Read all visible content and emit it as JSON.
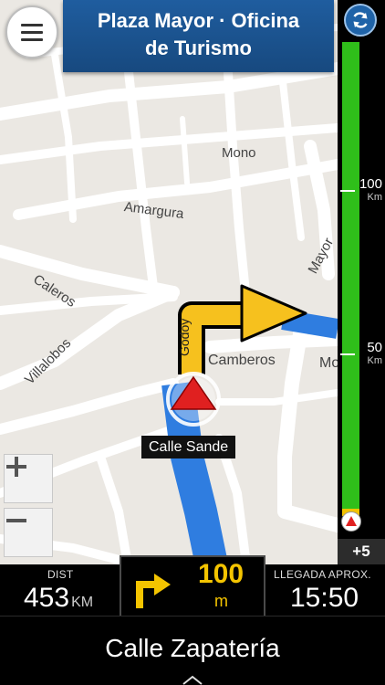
{
  "header": {
    "destination_line1": "Plaza Mayor · Oficina",
    "destination_line2": "de Turismo",
    "menu_icon": "hamburger-menu-icon",
    "refresh_icon": "refresh-icon"
  },
  "map": {
    "streets": {
      "mono": "Mono",
      "amargura": "Amargura",
      "caleros": "Caleros",
      "villalobos": "Villalobos",
      "godoy": "Godoy",
      "camberos": "Camberos",
      "mayor": "Mayor",
      "mo_partial": "Mo"
    },
    "current_street_callout": "Calle Sande",
    "zoom_in_label": "+",
    "zoom_out_label": "−",
    "colors": {
      "background": "#ebe8e3",
      "road": "#ffffff",
      "route": "#2f7de0",
      "maneuver_arrow": "#f6c11e",
      "position_marker": "#e02020"
    }
  },
  "traffic_bar": {
    "marks": [
      {
        "value": "100",
        "unit": "Km"
      },
      {
        "value": "50",
        "unit": "Km"
      }
    ],
    "delay": "+5",
    "colors": {
      "free_flow": "#2fbf1a",
      "slow": "#f2c200"
    }
  },
  "info": {
    "dist_label": "DIST",
    "dist_value": "453",
    "dist_unit": "KM",
    "next_turn_distance": "100",
    "next_turn_unit": "m",
    "next_turn_icon": "turn-right-icon",
    "eta_label": "LLEGADA APROX.",
    "eta_value": "15:50"
  },
  "next_street": "Calle Zapatería",
  "expand_icon": "chevron-up-icon"
}
